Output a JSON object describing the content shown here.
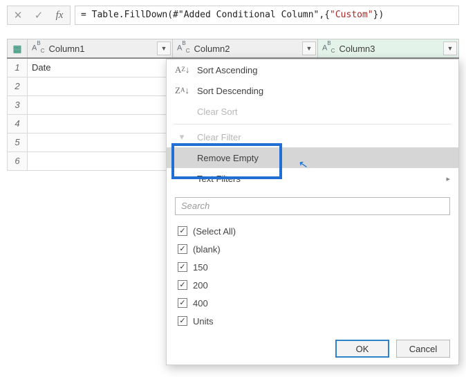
{
  "formula": {
    "prefix": "= Table.FillDown(#\"Added Conditional Column\",{",
    "arg": "\"Custom\"",
    "suffix": "})"
  },
  "columns": {
    "c1": "Column1",
    "c2": "Column2",
    "c3": "Column3"
  },
  "rows": [
    {
      "i": "1",
      "c1": "Date"
    },
    {
      "i": "2",
      "c1": ""
    },
    {
      "i": "3",
      "c1": ""
    },
    {
      "i": "4",
      "c1": ""
    },
    {
      "i": "5",
      "c1": ""
    },
    {
      "i": "6",
      "c1": ""
    }
  ],
  "menu": {
    "sort_asc": "Sort Ascending",
    "sort_desc": "Sort Descending",
    "clear_sort": "Clear Sort",
    "clear_filter": "Clear Filter",
    "remove_empty": "Remove Empty",
    "text_filters": "Text Filters",
    "search_placeholder": "Search"
  },
  "filter_values": [
    "(Select All)",
    "(blank)",
    "150",
    "200",
    "400",
    "Units"
  ],
  "buttons": {
    "ok": "OK",
    "cancel": "Cancel"
  }
}
